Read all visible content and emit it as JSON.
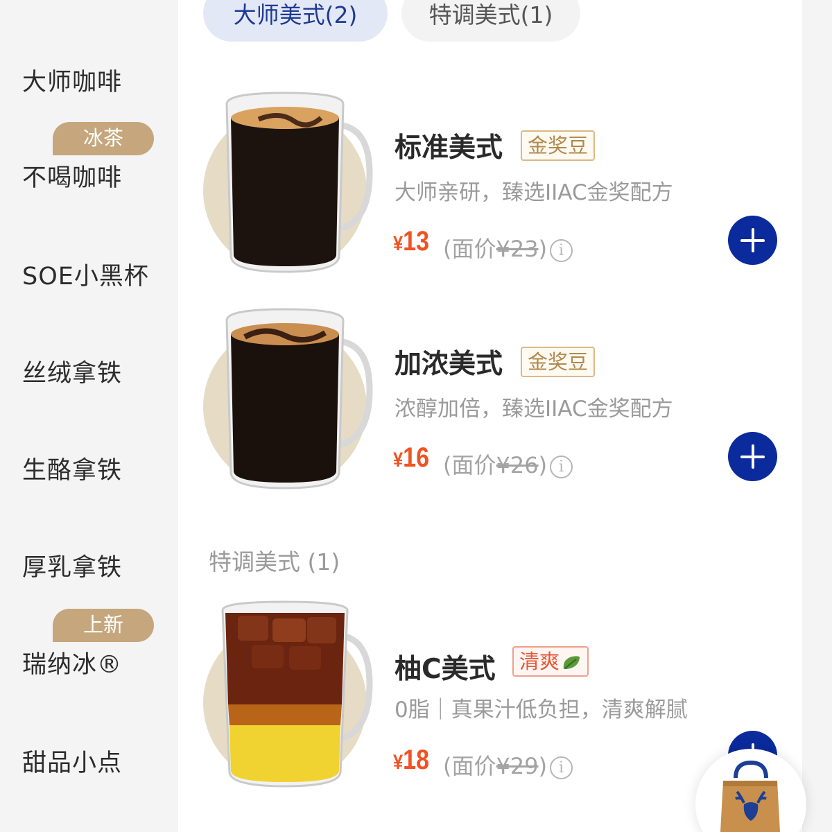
{
  "sidebar": {
    "items": [
      {
        "label": "大师咖啡",
        "badge": ""
      },
      {
        "label": "不喝咖啡",
        "badge": "冰茶"
      },
      {
        "label": "SOE小黑杯",
        "badge": ""
      },
      {
        "label": "丝绒拿铁",
        "badge": ""
      },
      {
        "label": "生酪拿铁",
        "badge": ""
      },
      {
        "label": "厚乳拿铁",
        "badge": ""
      },
      {
        "label": "瑞纳冰®",
        "badge": "上新"
      },
      {
        "label": "甜品小点",
        "badge": ""
      }
    ]
  },
  "tabs": [
    {
      "label": "大师美式(2)",
      "active": true
    },
    {
      "label": "特调美式(1)",
      "active": false
    }
  ],
  "products": [
    {
      "name": "标准美式",
      "tag": "金奖豆",
      "desc": "大师亲研，臻选IIAC金奖配方",
      "currency": "¥",
      "price": "13",
      "face_prefix": "(面价",
      "face_price": "¥23",
      "face_suffix": ")",
      "info": "i"
    },
    {
      "name": "加浓美式",
      "tag": "金奖豆",
      "desc": "浓醇加倍，臻选IIAC金奖配方",
      "currency": "¥",
      "price": "16",
      "face_prefix": "(面价",
      "face_price": "¥26",
      "face_suffix": ")",
      "info": "i"
    },
    {
      "name": "柚C美式",
      "tag": "清爽",
      "desc": "0脂｜真果汁低负担，清爽解腻",
      "currency": "¥",
      "price": "18",
      "face_prefix": "(面价",
      "face_price": "¥29",
      "face_suffix": ")",
      "info": "i"
    }
  ],
  "section": {
    "title": "特调美式 (1)"
  },
  "colors": {
    "accent": "#0b2a9c",
    "price": "#f05223",
    "badge": "#c6a67c",
    "tab_active_bg": "#e3e8f6"
  },
  "icons": {
    "add": "plus-circle-icon",
    "cart": "shopping-bag-icon",
    "leaf": "leaf-icon",
    "info": "info-icon"
  }
}
